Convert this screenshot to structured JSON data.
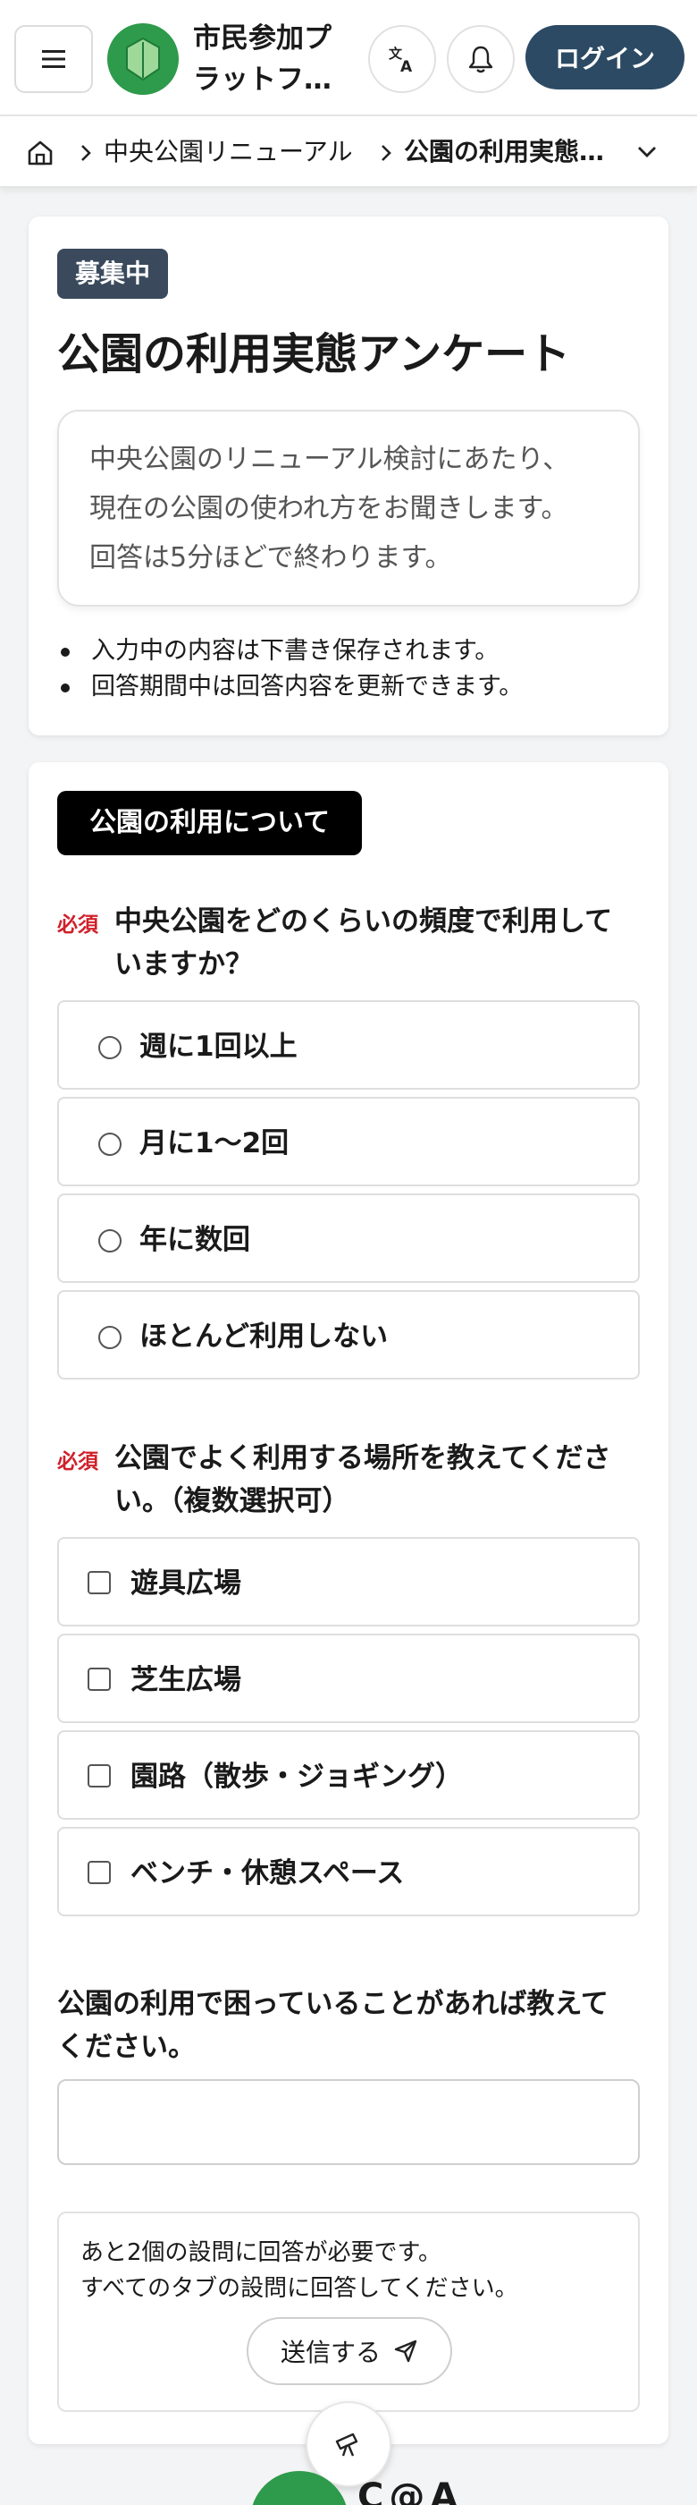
{
  "header": {
    "brand_name": "市民参加プラットフォーム",
    "login_label": "ログイン"
  },
  "breadcrumb": {
    "parent": "中央公園リニューアル",
    "current": "公園の利用実態アンケート"
  },
  "intro": {
    "status": "募集中",
    "title": "公園の利用実態アンケート",
    "description": [
      "中央公園のリニューアル検討にあたり、",
      "現在の公園の使われ方をお聞きします。",
      "回答は5分ほどで終わります。"
    ],
    "notes": [
      "入力中の内容は下書き保存されます。",
      "回答期間中は回答内容を更新できます。"
    ]
  },
  "form": {
    "section_tab": "公園の利用について",
    "required_label": "必須",
    "q1": {
      "text_line1": "中央公園をどのくらいの頻度で利用して",
      "text_line2": "いますか？",
      "options": [
        "週に1回以上",
        "月に1〜2回",
        "年に数回",
        "ほとんど利用しない"
      ]
    },
    "q2": {
      "text_line1": "公園でよく利用する場所を教えてくださ",
      "text_line2": "い。（複数選択可）",
      "options": [
        "遊具広場",
        "芝生広場",
        "園路（散歩・ジョギング）",
        "ベンチ・休憩スペース"
      ]
    },
    "q3": {
      "text_line1": "公園の利用で困っていることがあれば教えて",
      "text_line2": "ください。",
      "value": "",
      "placeholder": ""
    },
    "submit": {
      "message_line1": "あと2個の設問に回答が必要です。",
      "message_line2": "すべてのタブの設問に回答してください。",
      "button_label": "送信する"
    }
  },
  "footer": {
    "brand_text": "C@A"
  },
  "colors": {
    "brand_green": "#2e9a4b",
    "navy": "#2c4a64",
    "required_red": "#d0202a",
    "status_badge": "#3a4a5c"
  },
  "icons": {
    "menu": "hamburger-icon",
    "translate": "translate-icon",
    "notification": "bell-icon",
    "home": "home-icon",
    "send": "paper-plane-icon",
    "fab": "telescope-icon"
  }
}
